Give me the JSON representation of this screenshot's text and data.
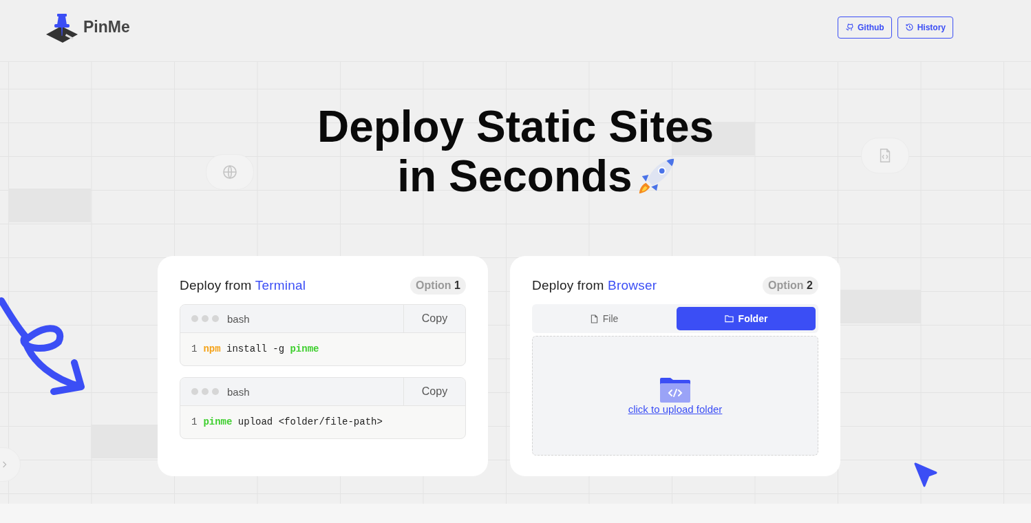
{
  "header": {
    "brand": "PinMe",
    "nav": [
      {
        "label": "Github"
      },
      {
        "label": "History"
      }
    ]
  },
  "hero": {
    "title_lines": [
      "Deploy Static Sites",
      "in Seconds"
    ]
  },
  "terminal_card": {
    "title": "Deploy from",
    "title_highlight": "Terminal",
    "badge_label": "Option",
    "badge_number": "1",
    "code_blocks": [
      {
        "language": "bash",
        "copy_label": "Copy",
        "line_number": "1",
        "tokens": [
          {
            "text": "npm",
            "kind": "command"
          },
          {
            "text": "install -g",
            "kind": "text"
          },
          {
            "text": "pinme",
            "kind": "package"
          }
        ]
      },
      {
        "language": "bash",
        "copy_label": "Copy",
        "line_number": "1",
        "tokens": [
          {
            "text": "pinme",
            "kind": "package"
          },
          {
            "text": "upload <folder/file-path>",
            "kind": "text"
          }
        ]
      }
    ]
  },
  "browser_card": {
    "title": "Deploy from",
    "title_highlight": "Browser",
    "badge_label": "Option",
    "badge_number": "2",
    "tabs": [
      {
        "label": "File",
        "selected": false
      },
      {
        "label": "Folder",
        "selected": true
      }
    ],
    "upload_link": "click to upload folder"
  }
}
